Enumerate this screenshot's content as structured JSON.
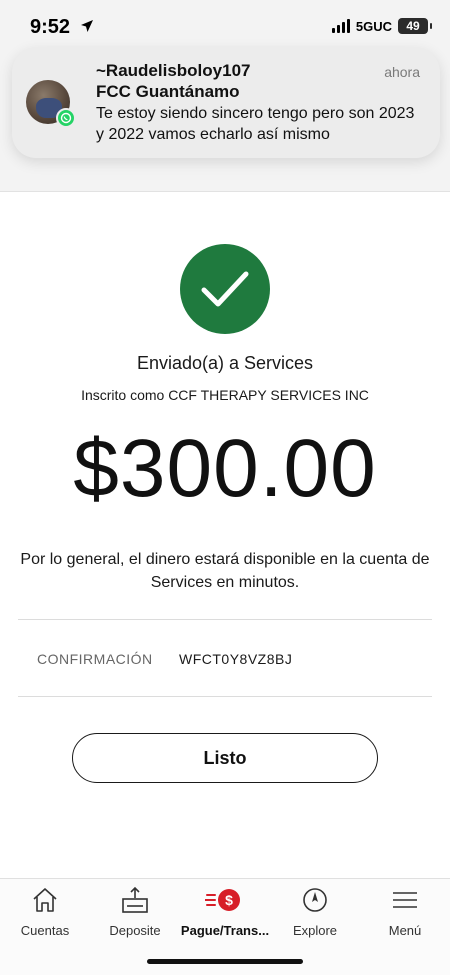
{
  "status_bar": {
    "time": "9:52",
    "network": "5GUC",
    "battery": "49"
  },
  "notification": {
    "sender": "~Raudelisboloy107",
    "group": "FCC Guantánamo",
    "time": "ahora",
    "message": "Te estoy siendo sincero tengo pero son 2023 y 2022 vamos echarlo así mismo",
    "app_icon": "whatsapp-icon"
  },
  "confirmation": {
    "status_icon": "checkmark-icon",
    "status_color": "#1f7a3e",
    "sent_to": "Enviado(a) a Services",
    "enrolled_as": "Inscrito como CCF THERAPY SERVICES INC",
    "amount": "$300.00",
    "availability": "Por lo general, el dinero estará disponible en la cuenta de Services en minutos.",
    "confirmation_label": "CONFIRMACIÓN",
    "confirmation_code": "WFCT0Y8VZ8BJ",
    "done_label": "Listo"
  },
  "bottom_nav": {
    "items": [
      {
        "label": "Cuentas",
        "icon": "house-icon"
      },
      {
        "label": "Deposite",
        "icon": "deposit-icon"
      },
      {
        "label": "Pague/Trans...",
        "icon": "pay-transfer-icon",
        "active": true,
        "accent": "#d71e28"
      },
      {
        "label": "Explore",
        "icon": "compass-icon"
      },
      {
        "label": "Menú",
        "icon": "menu-icon"
      }
    ]
  }
}
